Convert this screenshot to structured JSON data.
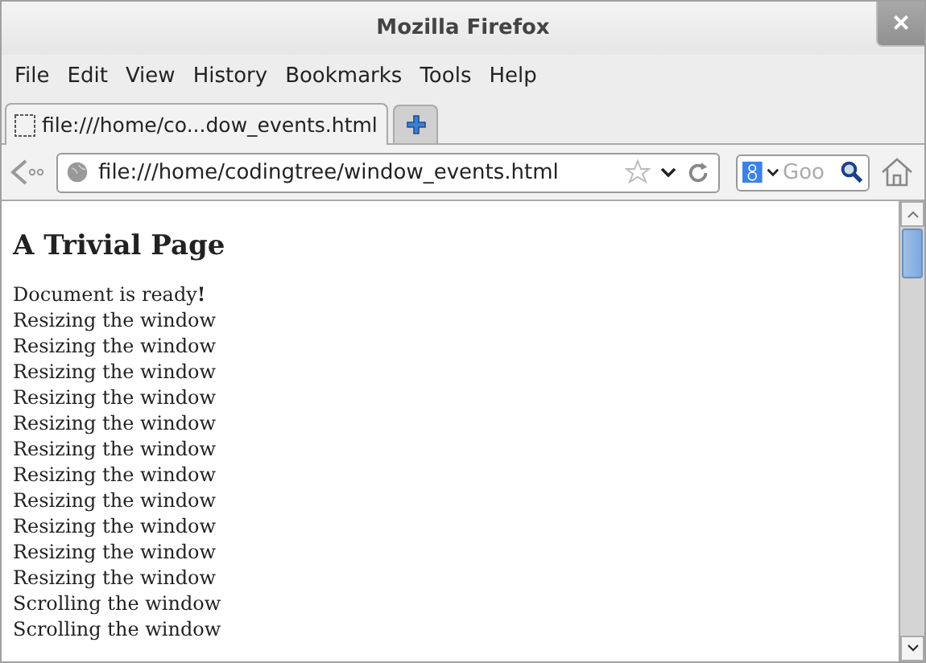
{
  "window": {
    "title": "Mozilla Firefox",
    "close": "×"
  },
  "menu": [
    {
      "label": "File"
    },
    {
      "label": "Edit"
    },
    {
      "label": "View"
    },
    {
      "label": "History"
    },
    {
      "label": "Bookmarks"
    },
    {
      "label": "Tools"
    },
    {
      "label": "Help"
    }
  ],
  "tabs": [
    {
      "label": "file:///home/co...dow_events.html",
      "selected": true
    }
  ],
  "address": {
    "value": "file:///home/codingtree/window_events.html"
  },
  "search": {
    "placeholder": "Goo"
  },
  "page": {
    "heading": "A Trivial Page",
    "lines": [
      "Document is ready**!**",
      "Resizing the window",
      "Resizing the window",
      "Resizing the window",
      "Resizing the window",
      "Resizing the window",
      "Resizing the window",
      "Resizing the window",
      "Resizing the window",
      "Resizing the window",
      "Resizing the window",
      "Resizing the window",
      "Scrolling the window",
      "Scrolling the window"
    ]
  }
}
